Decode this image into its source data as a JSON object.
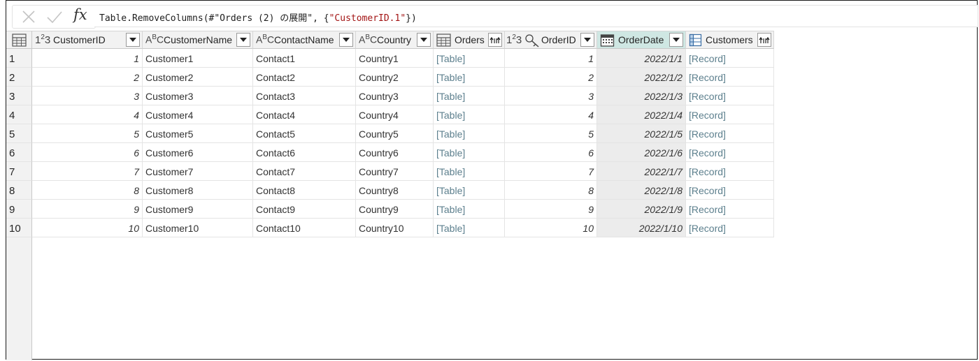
{
  "formula": {
    "prefix": "Table.RemoveColumns(#\"Orders (2) の展開\", {",
    "string": "\"CustomerID.1\"",
    "suffix": "})"
  },
  "formula_buttons": {
    "cancel_icon": "x-icon",
    "confirm_icon": "check-icon",
    "fx_label": "fx"
  },
  "columns": [
    {
      "key": "CustomerID",
      "label": "CustomerID",
      "type": "number",
      "control": "dropdown"
    },
    {
      "key": "CustomerName",
      "label": "CustomerName",
      "type": "text",
      "control": "dropdown"
    },
    {
      "key": "ContactName",
      "label": "ContactName",
      "type": "text",
      "control": "dropdown"
    },
    {
      "key": "Country",
      "label": "Country",
      "type": "text",
      "control": "dropdown"
    },
    {
      "key": "Orders",
      "label": "Orders",
      "type": "table",
      "control": "expand"
    },
    {
      "key": "OrderID",
      "label": "OrderID",
      "type": "number-key",
      "control": "dropdown"
    },
    {
      "key": "OrderDate",
      "label": "OrderDate",
      "type": "date",
      "control": "dropdown",
      "selected": true
    },
    {
      "key": "Customers",
      "label": "Customers",
      "type": "record",
      "control": "expand"
    }
  ],
  "rows": [
    {
      "n": "1",
      "CustomerID": "1",
      "CustomerName": "Customer1",
      "ContactName": "Contact1",
      "Country": "Country1",
      "Orders": "[Table]",
      "OrderID": "1",
      "OrderDate": "2022/1/1",
      "Customers": "[Record]"
    },
    {
      "n": "2",
      "CustomerID": "2",
      "CustomerName": "Customer2",
      "ContactName": "Contact2",
      "Country": "Country2",
      "Orders": "[Table]",
      "OrderID": "2",
      "OrderDate": "2022/1/2",
      "Customers": "[Record]"
    },
    {
      "n": "3",
      "CustomerID": "3",
      "CustomerName": "Customer3",
      "ContactName": "Contact3",
      "Country": "Country3",
      "Orders": "[Table]",
      "OrderID": "3",
      "OrderDate": "2022/1/3",
      "Customers": "[Record]"
    },
    {
      "n": "4",
      "CustomerID": "4",
      "CustomerName": "Customer4",
      "ContactName": "Contact4",
      "Country": "Country4",
      "Orders": "[Table]",
      "OrderID": "4",
      "OrderDate": "2022/1/4",
      "Customers": "[Record]"
    },
    {
      "n": "5",
      "CustomerID": "5",
      "CustomerName": "Customer5",
      "ContactName": "Contact5",
      "Country": "Country5",
      "Orders": "[Table]",
      "OrderID": "5",
      "OrderDate": "2022/1/5",
      "Customers": "[Record]"
    },
    {
      "n": "6",
      "CustomerID": "6",
      "CustomerName": "Customer6",
      "ContactName": "Contact6",
      "Country": "Country6",
      "Orders": "[Table]",
      "OrderID": "6",
      "OrderDate": "2022/1/6",
      "Customers": "[Record]"
    },
    {
      "n": "7",
      "CustomerID": "7",
      "CustomerName": "Customer7",
      "ContactName": "Contact7",
      "Country": "Country7",
      "Orders": "[Table]",
      "OrderID": "7",
      "OrderDate": "2022/1/7",
      "Customers": "[Record]"
    },
    {
      "n": "8",
      "CustomerID": "8",
      "CustomerName": "Customer8",
      "ContactName": "Contact8",
      "Country": "Country8",
      "Orders": "[Table]",
      "OrderID": "8",
      "OrderDate": "2022/1/8",
      "Customers": "[Record]"
    },
    {
      "n": "9",
      "CustomerID": "9",
      "CustomerName": "Customer9",
      "ContactName": "Contact9",
      "Country": "Country9",
      "Orders": "[Table]",
      "OrderID": "9",
      "OrderDate": "2022/1/9",
      "Customers": "[Record]"
    },
    {
      "n": "10",
      "CustomerID": "10",
      "CustomerName": "Customer10",
      "ContactName": "Contact10",
      "Country": "Country10",
      "Orders": "[Table]",
      "OrderID": "10",
      "OrderDate": "2022/1/10",
      "Customers": "[Record]"
    }
  ],
  "colors": {
    "selected_header": "#cfe7e3",
    "link_text": "#5c7f8d",
    "string_literal": "#a31515"
  }
}
